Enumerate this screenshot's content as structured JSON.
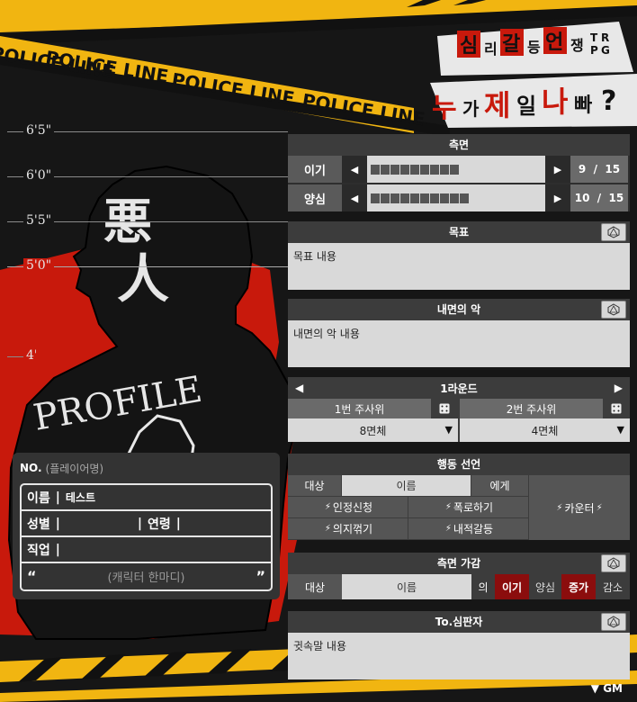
{
  "logo": {
    "line1_chars": [
      "심",
      "리",
      "갈",
      "등",
      "언",
      "쟁"
    ],
    "trpg": [
      "T",
      "R",
      "P",
      "G"
    ],
    "line2_chars": [
      "누",
      "가",
      "제",
      "일",
      "나",
      "빠",
      "?"
    ]
  },
  "tape_text": "POLICE LINE",
  "heights": [
    "6'5\"",
    "6'0\"",
    "5'5\"",
    "5'0\"",
    "4'0\""
  ],
  "figure": {
    "kanji": [
      "悪",
      "人"
    ],
    "profile_text": "PROFILE"
  },
  "profile": {
    "no_label": "NO.",
    "player_placeholder": "(플레이어명)",
    "name_label": "이름",
    "name_value": "테스트",
    "gender_label": "성별",
    "age_label": "연령",
    "job_label": "직업",
    "quote_open": "“",
    "quote_placeholder": "(캐릭터 한마디)",
    "quote_close": "”"
  },
  "aspect": {
    "title": "측면",
    "rows": [
      {
        "label": "이기",
        "value": 9,
        "max": 15,
        "value_text": "9",
        "max_text": "15",
        "filled": 9,
        "total": 9
      },
      {
        "label": "양심",
        "value": 10,
        "max": 15,
        "value_text": "10",
        "max_text": "15",
        "filled": 10,
        "total": 10
      }
    ],
    "slash": "/"
  },
  "goal": {
    "title": "목표",
    "content": "목표 내용"
  },
  "inner_evil": {
    "title": "내면의 악",
    "content": "내면의 악 내용"
  },
  "round": {
    "title": "1라운드",
    "dice1_label": "1번 주사위",
    "dice2_label": "2번 주사위",
    "dice1_value": "8면체",
    "dice2_value": "4면체"
  },
  "action": {
    "title": "행동 선언",
    "target_label": "대상",
    "target_value": "이름",
    "to_label": "에게",
    "btn_recognition": "인정신청",
    "btn_expose": "폭로하기",
    "btn_break": "의지꺾기",
    "btn_inner": "내적갈등",
    "btn_counter": "카운터"
  },
  "aspect_adjust": {
    "title": "측면 가감",
    "target_label": "대상",
    "target_value": "이름",
    "of_label": "의",
    "opt1": "이기",
    "opt2": "양심",
    "inc": "증가",
    "dec": "감소"
  },
  "judge": {
    "title": "To.심판자",
    "content": "귓속말 내용"
  },
  "gm": {
    "arrow": "▼",
    "label": "GM"
  },
  "colors": {
    "tape": "#f1b511",
    "red": "#c8190c",
    "dark_red": "#a10a0a",
    "panel": "#3c3c3c",
    "field": "#d9d9d9"
  },
  "icons": [
    "dice-icon",
    "d20-icon",
    "bolt-icon",
    "chevron-down-icon",
    "arrow-left-icon",
    "arrow-right-icon"
  ]
}
